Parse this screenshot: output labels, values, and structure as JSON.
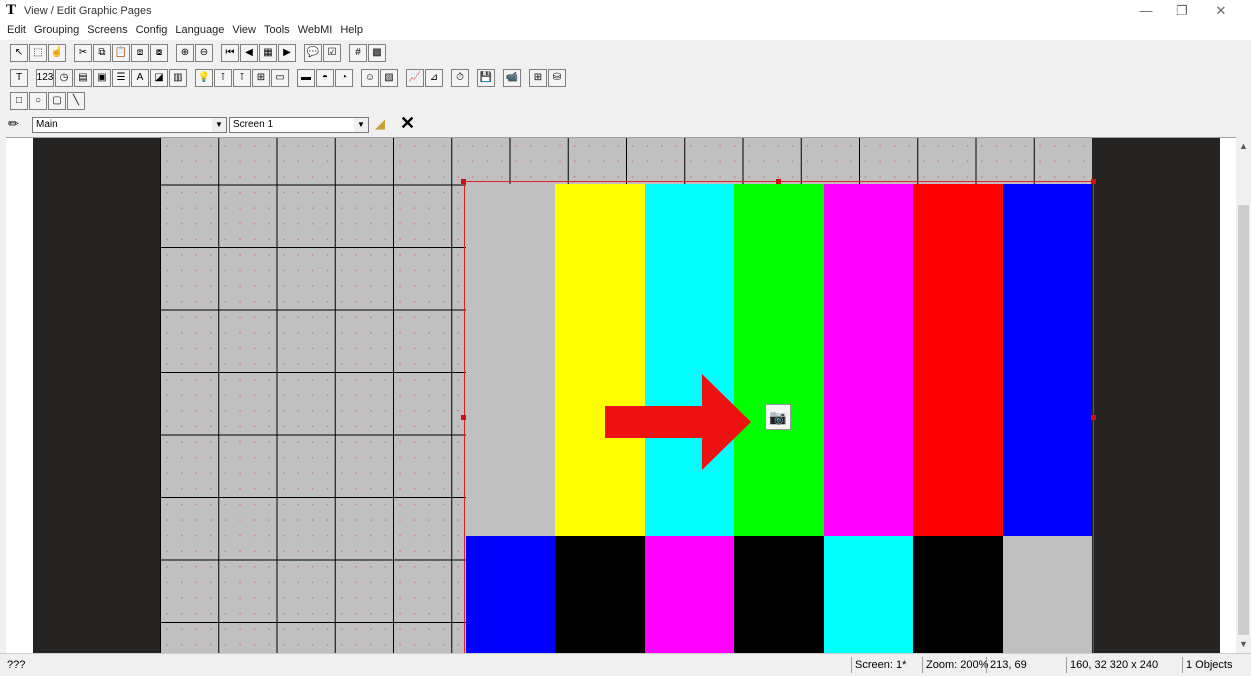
{
  "window": {
    "title": "View / Edit Graphic Pages",
    "app_icon": "T"
  },
  "menu": [
    "Edit",
    "Grouping",
    "Screens",
    "Config",
    "Language",
    "View",
    "Tools",
    "WebMI",
    "Help"
  ],
  "toolbar1": [
    {
      "icon": "pointer-icon",
      "glyph": "↖"
    },
    {
      "icon": "marquee-select-icon",
      "glyph": "⬚"
    },
    {
      "icon": "hand-pointer-icon",
      "glyph": "☝"
    },
    {
      "icon": "cut-icon",
      "glyph": "✂",
      "gap": true
    },
    {
      "icon": "copy-icon",
      "glyph": "⧉"
    },
    {
      "icon": "paste-icon",
      "glyph": "📋"
    },
    {
      "icon": "bring-front-icon",
      "glyph": "⧈"
    },
    {
      "icon": "send-back-icon",
      "glyph": "⧇"
    },
    {
      "icon": "zoom-in-icon",
      "glyph": "⊕",
      "gap": true
    },
    {
      "icon": "zoom-out-icon",
      "glyph": "⊖"
    },
    {
      "icon": "first-screen-icon",
      "glyph": "⏮",
      "gap": true
    },
    {
      "icon": "prev-screen-icon",
      "glyph": "◀"
    },
    {
      "icon": "screen-list-icon",
      "glyph": "▦"
    },
    {
      "icon": "next-screen-icon",
      "glyph": "▶"
    },
    {
      "icon": "help-bubble-icon",
      "glyph": "💬",
      "gap": true
    },
    {
      "icon": "properties-icon",
      "glyph": "☑"
    },
    {
      "icon": "grid-icon",
      "glyph": "#",
      "gap": true
    },
    {
      "icon": "fill-grid-icon",
      "glyph": "▩"
    }
  ],
  "toolbar2": [
    {
      "icon": "text-icon",
      "glyph": "T"
    },
    {
      "icon": "numeric-icon",
      "glyph": "123",
      "gap": true
    },
    {
      "icon": "clock-icon",
      "glyph": "◷"
    },
    {
      "icon": "hmi-icon",
      "glyph": "▤"
    },
    {
      "icon": "password-icon",
      "glyph": "▣"
    },
    {
      "icon": "list-icon",
      "glyph": "☰"
    },
    {
      "icon": "alarm-text-icon",
      "glyph": "A"
    },
    {
      "icon": "notepad-icon",
      "glyph": "◪"
    },
    {
      "icon": "image-icon",
      "glyph": "▥"
    },
    {
      "icon": "bulb-icon",
      "glyph": "💡",
      "gap": true
    },
    {
      "icon": "switch-icon",
      "glyph": "⊺"
    },
    {
      "icon": "switch-group-icon",
      "glyph": "⊺"
    },
    {
      "icon": "slider-icon",
      "glyph": "⊞"
    },
    {
      "icon": "monitor-icon",
      "glyph": "▭"
    },
    {
      "icon": "button-icon",
      "glyph": "▬",
      "gap": true
    },
    {
      "icon": "gauge-icon",
      "glyph": "◓"
    },
    {
      "icon": "dial-icon",
      "glyph": "◔"
    },
    {
      "icon": "person-icon",
      "glyph": "☺",
      "gap": true
    },
    {
      "icon": "recipe-icon",
      "glyph": "▧"
    },
    {
      "icon": "trend-icon",
      "glyph": "📈",
      "gap": true
    },
    {
      "icon": "xy-plot-icon",
      "glyph": "⊿"
    },
    {
      "icon": "timer-icon",
      "glyph": "⏱",
      "gap": true
    },
    {
      "icon": "save-icon",
      "glyph": "💾",
      "gap": true
    },
    {
      "icon": "camera-icon",
      "glyph": "📹",
      "gap": true
    },
    {
      "icon": "table-icon",
      "glyph": "⊞",
      "gap": true
    },
    {
      "icon": "database-icon",
      "glyph": "⛁"
    }
  ],
  "toolbar3": [
    {
      "icon": "rectangle-icon",
      "glyph": "□"
    },
    {
      "icon": "circle-icon",
      "glyph": "○"
    },
    {
      "icon": "rounded-rect-icon",
      "glyph": "▢"
    },
    {
      "icon": "line-icon",
      "glyph": "╲"
    }
  ],
  "selector": {
    "group": "Main",
    "screen": "Screen 1"
  },
  "test_pattern": {
    "top_colors": [
      "#c0c0c0",
      "#ffff00",
      "#00ffff",
      "#00ff00",
      "#ff00ff",
      "#ff0000",
      "#0000ff"
    ],
    "bottom_colors": [
      "#0000ff",
      "#000000",
      "#ff00ff",
      "#000000",
      "#00ffff",
      "#000000",
      "#c0c0c0"
    ]
  },
  "status": {
    "message": "???",
    "screen": "Screen: 1*",
    "zoom": "Zoom: 200%",
    "cursor": "213, 69",
    "selection": "160, 32  320 x 240",
    "objects": "1 Objects"
  },
  "colors": {
    "dark_area": "#262323",
    "grid_bg": "#c0c0c0",
    "selection": "#e02020",
    "arrow": "#ee1111"
  }
}
